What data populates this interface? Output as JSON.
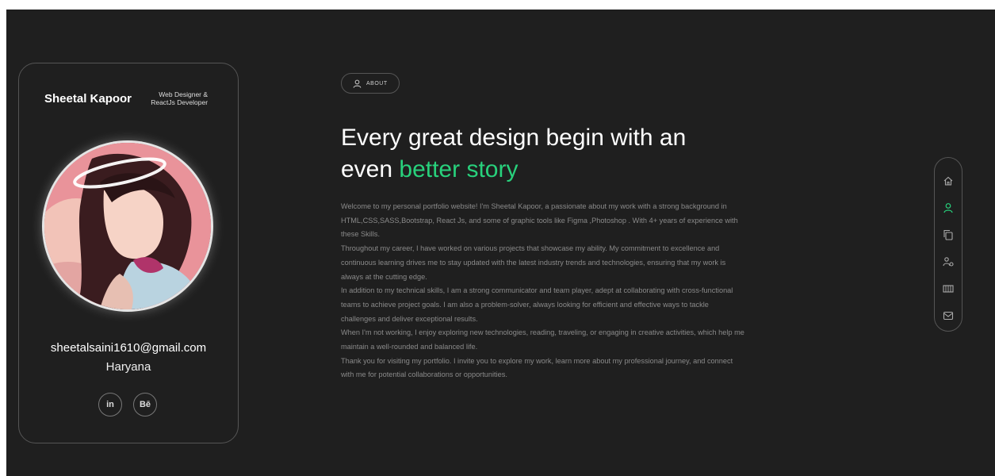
{
  "profile": {
    "name": "Sheetal Kapoor",
    "role_line1": "Web Designer &",
    "role_line2": "ReactJs Developer",
    "email": "sheetalsaini1610@gmail.com",
    "location": "Haryana",
    "socials": [
      {
        "label": "in",
        "icon": "linkedin-icon"
      },
      {
        "label": "Bē",
        "icon": "behance-icon"
      }
    ]
  },
  "about_chip": {
    "label": "ABOUT",
    "icon": "user-icon"
  },
  "headline": {
    "line1": "Every great design begin with an",
    "line2_plain": "even ",
    "line2_accent": "better story"
  },
  "bio": [
    "Welcome to my personal portfolio website! I'm Sheetal Kapoor, a passionate about my work with a strong background in HTML,CSS,SASS,Bootstrap, React Js, and some of graphic tools like Figma ,Photoshop . With 4+ years of experience with these Skills.",
    "Throughout my career, I have worked on various projects that showcase my ability. My commitment to excellence and continuous learning drives me to stay updated with the latest industry trends and technologies, ensuring that my work is always at the cutting edge.",
    "In addition to my technical skills, I am a strong communicator and team player, adept at collaborating with cross-functional teams to achieve project goals. I am also a problem-solver, always looking for efficient and effective ways to tackle challenges and deliver exceptional results.",
    "When I'm not working, I enjoy exploring new technologies, reading, traveling, or engaging in creative activities, which help me maintain a well-rounded and balanced life.",
    "Thank you for visiting my portfolio. I invite you to explore my work, learn more about my professional journey, and connect with me for potential collaborations or opportunities."
  ],
  "side_nav": [
    {
      "icon": "home-icon",
      "active": false
    },
    {
      "icon": "user-icon",
      "active": true
    },
    {
      "icon": "copy-icon",
      "active": false
    },
    {
      "icon": "skills-icon",
      "active": false
    },
    {
      "icon": "portfolio-icon",
      "active": false
    },
    {
      "icon": "mail-icon",
      "active": false
    }
  ],
  "colors": {
    "background": "#1f1f1f",
    "accent": "#28d17c",
    "text_muted": "#8a8a8a"
  }
}
